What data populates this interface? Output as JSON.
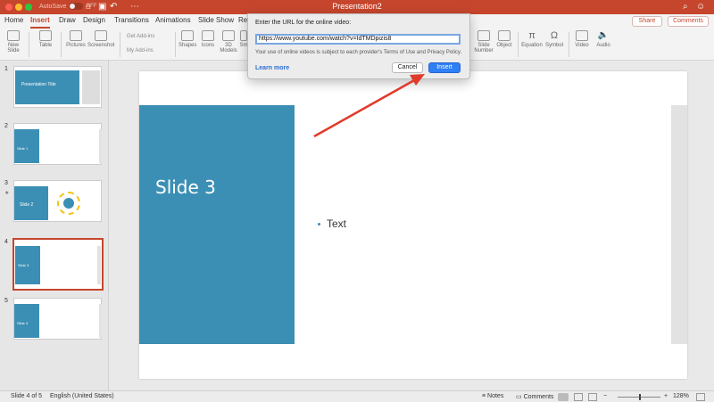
{
  "titlebar": {
    "autosave_label": "AutoSave",
    "autosave_state": "OFF",
    "doc_title": "Presentation2"
  },
  "tabs": {
    "items": [
      "Home",
      "Insert",
      "Draw",
      "Design",
      "Transitions",
      "Animations",
      "Slide Show",
      "Re"
    ],
    "active": "Insert",
    "share": "Share",
    "comments": "Comments"
  },
  "ribbon": {
    "new_slide": "New Slide",
    "table": "Table",
    "pictures": "Pictures",
    "screenshot": "Screenshot",
    "get_addins": "Get Add-ins",
    "my_addins": "My Add-ins",
    "shapes": "Shapes",
    "icons": "Icons",
    "models_3d": "3D Models",
    "sm": "Sm",
    "slide_number": "Slide Number",
    "object": "Object",
    "equation": "Equation",
    "symbol": "Symbol",
    "video": "Video",
    "audio": "Audio"
  },
  "sidebar": {
    "slides": [
      {
        "num": "1",
        "title": "Presentation Title"
      },
      {
        "num": "2",
        "title": "Slide 1"
      },
      {
        "num": "3",
        "title": "Slide 2"
      },
      {
        "num": "4",
        "title": "Slide 3"
      },
      {
        "num": "5",
        "title": "Slide 4"
      }
    ]
  },
  "slide": {
    "title": "Slide 3",
    "bullet": "Text"
  },
  "dialog": {
    "label": "Enter the URL for the online video:",
    "url": "https://www.youtube.com/watch?v=IdTMDpizis8",
    "note": "Your use of online videos is subject to each provider's Terms of Use and Privacy Policy.",
    "learn_more": "Learn more",
    "cancel": "Cancel",
    "insert": "Insert"
  },
  "statusbar": {
    "slide_info": "Slide 4 of 5",
    "language": "English (United States)",
    "notes": "Notes",
    "comments": "Comments",
    "zoom": "128%"
  },
  "colors": {
    "accent": "#c5462d",
    "slide_blue": "#3c8fb4",
    "insert_button": "#2f7ff5",
    "arrow": "#e03a2a"
  }
}
